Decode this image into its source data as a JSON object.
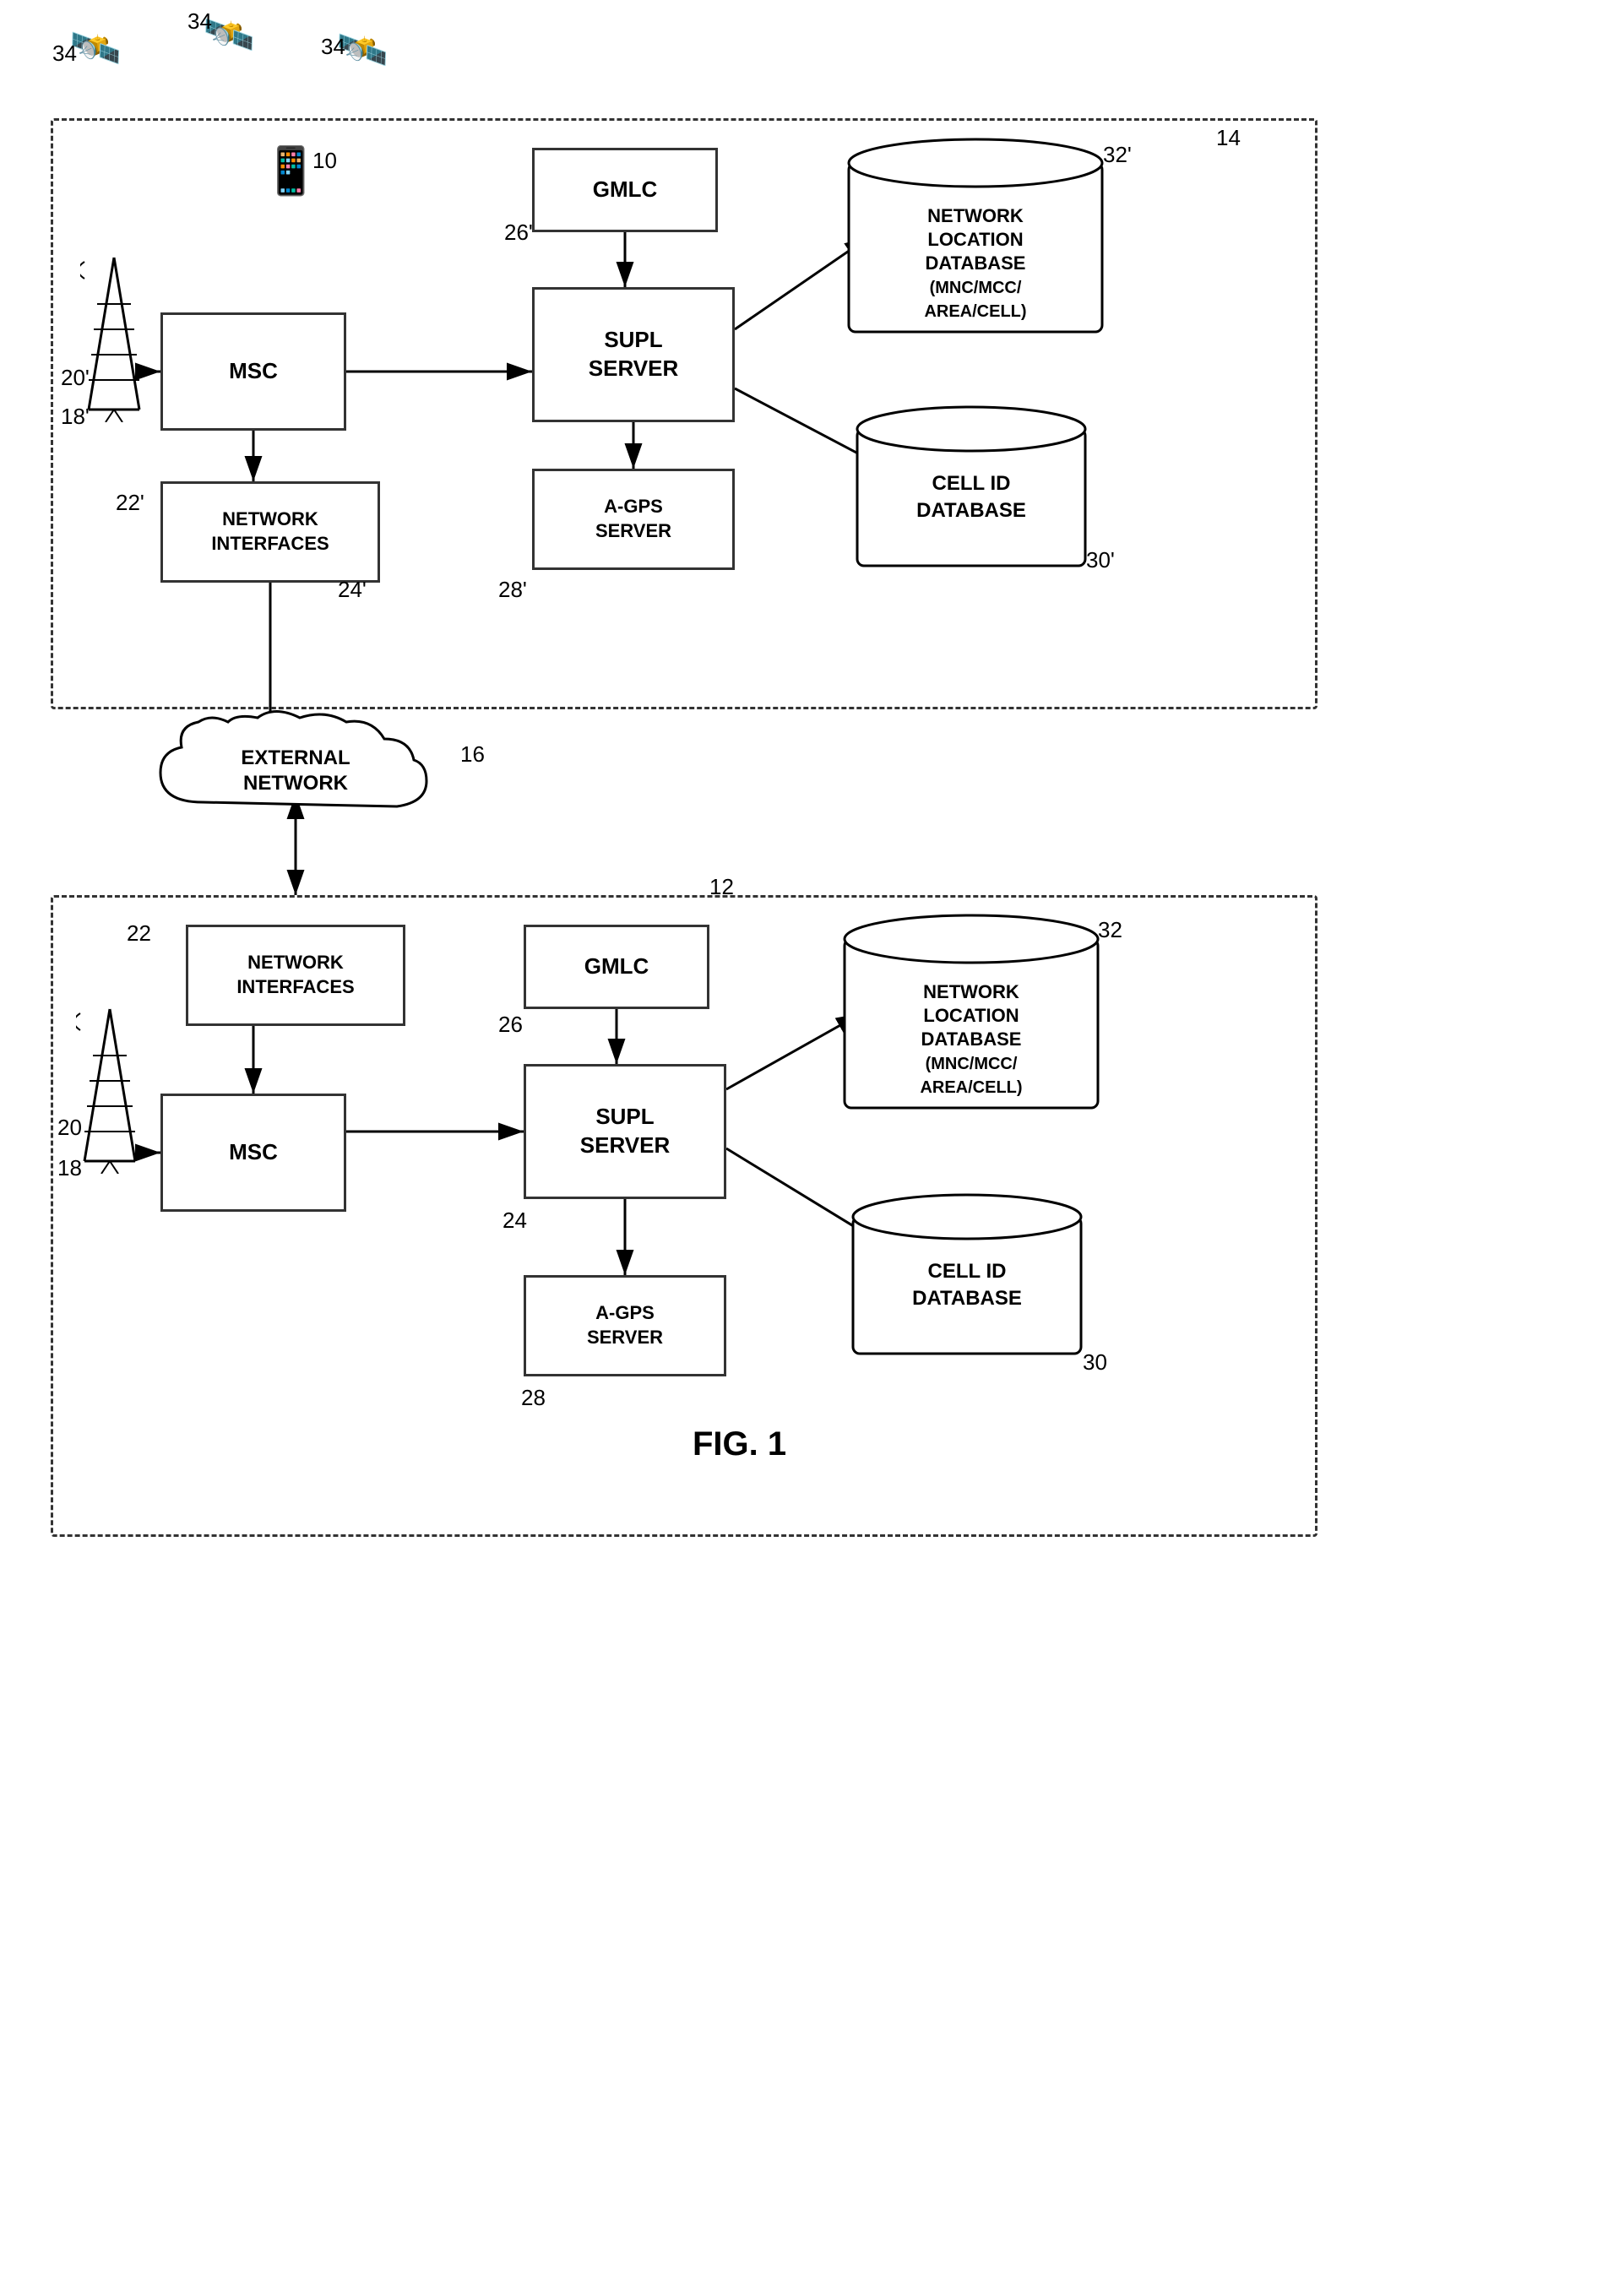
{
  "title": "FIG. 1",
  "fig_label": "FIG. 1",
  "top_diagram": {
    "ref": "14",
    "gmlc": "GMLC",
    "msc": "MSC",
    "supl_server": "SUPL\nSERVER",
    "network_interfaces": "NETWORK\nINTERFACES",
    "agps_server": "A-GPS\nSERVER",
    "network_loc_db": "NETWORK\nLOCATION\nDATABASE\n(MNC/MCC/\nAREA/CELL)",
    "cell_id_db": "CELL ID\nDATABASE",
    "refs": {
      "r10": "10",
      "r18p": "18'",
      "r20p": "20'",
      "r22p": "22'",
      "r24p": "24'",
      "r26p": "26'",
      "r28p": "28'",
      "r30p": "30'",
      "r32p": "32'",
      "r34a": "34",
      "r34b": "34",
      "r34c": "34"
    }
  },
  "external_network": {
    "label": "EXTERNAL\nNETWORK",
    "ref": "16"
  },
  "bottom_diagram": {
    "ref": "12",
    "gmlc": "GMLC",
    "msc": "MSC",
    "supl_server": "SUPL\nSERVER",
    "network_interfaces": "NETWORK\nINTERFACES",
    "agps_server": "A-GPS\nSERVER",
    "network_loc_db": "NETWORK\nLOCATION\nDATABASE\n(MNC/MCC/\nAREA/CELL)",
    "cell_id_db": "CELL ID\nDATABASE",
    "refs": {
      "r18": "18",
      "r20": "20",
      "r22": "22",
      "r24": "24",
      "r26": "26",
      "r28": "28",
      "r30": "30",
      "r32": "32"
    }
  }
}
